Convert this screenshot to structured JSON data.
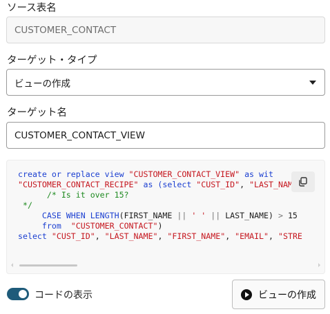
{
  "source_table": {
    "label": "ソース表名",
    "value": "CUSTOMER_CONTACT"
  },
  "target_type": {
    "label": "ターゲット・タイプ",
    "selected": "ビューの作成"
  },
  "target_name": {
    "label": "ターゲット名",
    "value": "CUSTOMER_CONTACT_VIEW"
  },
  "code": {
    "line1": {
      "kw1": "create or replace view ",
      "str1": "\"CUSTOMER_CONTACT_VIEW\"",
      "kw2": " as wit"
    },
    "line2": {
      "str1": "\"CUSTOMER_CONTACT_RECIPE\"",
      "kw1": " as (select ",
      "str2": "\"CUST_ID\"",
      "t1": ", ",
      "str3": "\"LAST_NAME\""
    },
    "line3": "      /* Is it over 15?",
    "line4": " */",
    "line5": {
      "indent": "     ",
      "kw1": "CASE WHEN LENGTH",
      "t1": "(FIRST_NAME ",
      "op1": "||",
      "t2": " ",
      "str1": "' '",
      "t3": " ",
      "op2": "||",
      "t4": " LAST_NAME) ",
      "op3": ">",
      "t5": " 15"
    },
    "line6": {
      "indent": "     ",
      "kw1": "from",
      "t1": "  ",
      "str1": "\"CUSTOMER_CONTACT\"",
      "t2": ")"
    },
    "line7": {
      "kw1": "select ",
      "str1": "\"CUST_ID\"",
      "t1": ", ",
      "str2": "\"LAST_NAME\"",
      "t2": ", ",
      "str3": "\"FIRST_NAME\"",
      "t3": ", ",
      "str4": "\"EMAIL\"",
      "t4": ", ",
      "str5": "\"STRE"
    },
    "copy_icon": "copy-icon"
  },
  "show_code": {
    "label": "コードの表示",
    "on": true
  },
  "create_button": {
    "label": "ビューの作成",
    "icon": "play-circle-icon"
  },
  "colors": {
    "accent": "#1e5b7a",
    "keyword": "#1b3fd1",
    "string": "#c5161e",
    "comment": "#1f8a21"
  }
}
